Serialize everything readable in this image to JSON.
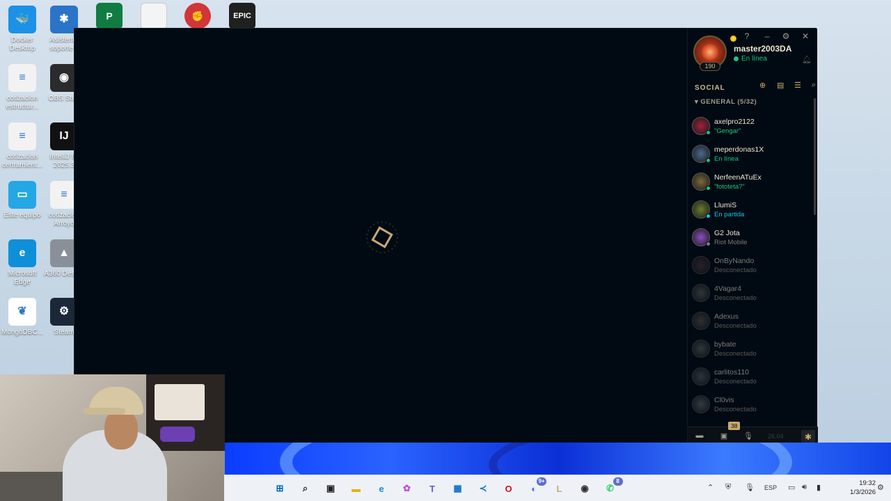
{
  "desktop": {
    "top_icons": [
      {
        "name": "project-icon",
        "glyph": "P",
        "color": "#107c41"
      },
      {
        "name": "document-icon",
        "glyph": "",
        "color": "#f4f4f4"
      },
      {
        "name": "riot-client-icon",
        "glyph": "✊",
        "color": "#d13639"
      },
      {
        "name": "epic-games-icon",
        "glyph": "EPIC",
        "color": "#202020"
      }
    ],
    "icons": [
      {
        "label": "Docker Desktop",
        "name": "docker-icon",
        "glyph": "🐳",
        "color": "#1d91e6"
      },
      {
        "label": "Asistente soporte v",
        "name": "support-assistant-icon",
        "glyph": "✱",
        "color": "#2b74c8"
      },
      {
        "label": "cotizacion estructur...",
        "name": "quotation-doc-icon",
        "glyph": "≡",
        "color": "#f2f2f2"
      },
      {
        "label": "OBS Stud",
        "name": "obs-icon",
        "glyph": "◉",
        "color": "#2b2b2b"
      },
      {
        "label": "cotizacion certramient...",
        "name": "quotation-doc-icon-2",
        "glyph": "≡",
        "color": "#f2f2f2"
      },
      {
        "label": "IntelliJ ID 2025.3",
        "name": "intellij-icon",
        "glyph": "IJ",
        "color": "#111111"
      },
      {
        "label": "Este equipo",
        "name": "this-pc-icon",
        "glyph": "▭",
        "color": "#25a7e6"
      },
      {
        "label": "cotizacion Arroyo",
        "name": "quotation-doc-icon-3",
        "glyph": "≡",
        "color": "#f2f2f2"
      },
      {
        "label": "Microsoft Edge",
        "name": "edge-icon",
        "glyph": "e",
        "color": "#0f8fd8"
      },
      {
        "label": "A360 Deskto",
        "name": "a360-icon",
        "glyph": "▲",
        "color": "#8a9099"
      },
      {
        "label": "MongoDBC...",
        "name": "mongodb-icon",
        "glyph": "❦",
        "color": "#ffffff"
      },
      {
        "label": "Steam",
        "name": "steam-icon",
        "glyph": "⚙",
        "color": "#1b2838"
      }
    ]
  },
  "client": {
    "profile": {
      "username": "master2003DA",
      "status": "En línea",
      "level": "190"
    },
    "controls": [
      "?",
      "–",
      "⚙",
      "✕"
    ],
    "social": {
      "title": "SOCIAL",
      "group": "GENERAL (5/32)"
    },
    "friends": [
      {
        "name": "axelpro2122",
        "status": "\"Gengar\"",
        "state": "online",
        "avatar": "#a0213c",
        "status_color": "#1bc47d"
      },
      {
        "name": "meperdonas1X",
        "status": "En línea",
        "state": "online",
        "avatar": "#4a6a8c",
        "status_color": "#1bc47d"
      },
      {
        "name": "NerfeenATuEx",
        "status": "\"fototeta?\"",
        "state": "online",
        "avatar": "#7a6a3a",
        "status_color": "#1bc47d"
      },
      {
        "name": "LlumiS",
        "status": "En partida",
        "state": "ingame",
        "avatar": "#6b7a2f",
        "status_color": "#0acbe6"
      },
      {
        "name": "G2 Jota",
        "status": "Riot Mobile",
        "state": "mobile",
        "avatar": "#8a4fc0",
        "status_color": "#7b7a75"
      },
      {
        "name": "OnByNando",
        "status": "Desconectado",
        "state": "offline",
        "avatar": "#8a2a5a",
        "status_color": "#5b5a56"
      },
      {
        "name": "4Vagar4",
        "status": "Desconectado",
        "state": "offline",
        "avatar": "#6a6a6a",
        "status_color": "#5b5a56"
      },
      {
        "name": "Adexus",
        "status": "Desconectado",
        "state": "offline",
        "avatar": "#7a5a4a",
        "status_color": "#5b5a56"
      },
      {
        "name": "bybate",
        "status": "Desconectado",
        "state": "offline",
        "avatar": "#4a7a5a",
        "status_color": "#5b5a56"
      },
      {
        "name": "carlitos110",
        "status": "Desconectado",
        "state": "offline",
        "avatar": "#5a6a8a",
        "status_color": "#5b5a56"
      },
      {
        "name": "Cl0vis",
        "status": "Desconectado",
        "state": "offline",
        "avatar": "#6a7a8a",
        "status_color": "#5b5a56"
      }
    ],
    "bottom_bar": {
      "badge": "38",
      "version": "26.04"
    }
  },
  "taskbar": {
    "apps": [
      {
        "name": "start-icon",
        "glyph": "⊞",
        "color": "#0067c0"
      },
      {
        "name": "search-icon",
        "glyph": "⌕",
        "color": "#222222"
      },
      {
        "name": "task-view-icon",
        "glyph": "▣",
        "color": "#222222"
      },
      {
        "name": "file-explorer-icon",
        "glyph": "▬",
        "color": "#e8b100"
      },
      {
        "name": "edge-taskbar-icon",
        "glyph": "e",
        "color": "#0f8fd8"
      },
      {
        "name": "copilot-icon",
        "glyph": "✿",
        "color": "#c44fd6"
      },
      {
        "name": "teams-icon",
        "glyph": "T",
        "color": "#5b5fc7"
      },
      {
        "name": "store-icon",
        "glyph": "▦",
        "color": "#0d6fd1"
      },
      {
        "name": "vscode-icon",
        "glyph": "≺",
        "color": "#0a78d4"
      },
      {
        "name": "opera-icon",
        "glyph": "O",
        "color": "#e0101e"
      },
      {
        "name": "discord-icon",
        "glyph": "◐",
        "color": "#5865f2",
        "badge": "9+"
      },
      {
        "name": "league-icon",
        "glyph": "L",
        "color": "#c8aa6e"
      },
      {
        "name": "obs-taskbar-icon",
        "glyph": "◉",
        "color": "#2b2b2b"
      },
      {
        "name": "whatsapp-icon",
        "glyph": "✆",
        "color": "#25d366",
        "badge": "8"
      }
    ],
    "lang": "ESP",
    "time": "19:32",
    "date": "1/3/2026"
  }
}
